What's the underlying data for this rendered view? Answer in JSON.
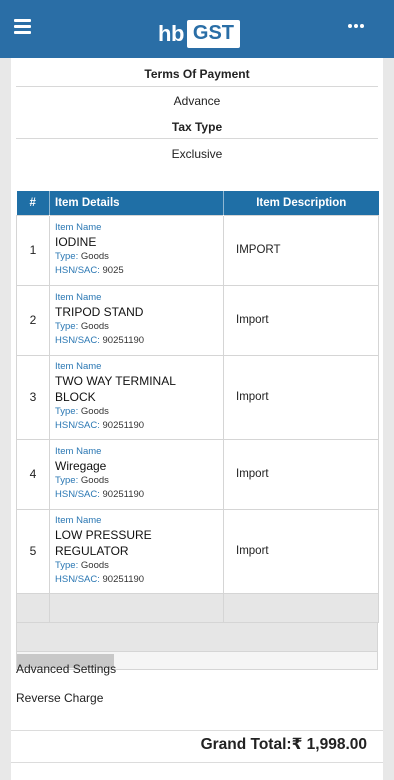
{
  "header": {
    "logo_hb": "hb",
    "logo_gst": "GST"
  },
  "payment": {
    "terms_label": "Terms Of Payment",
    "terms_value": "Advance",
    "tax_type_label": "Tax Type",
    "tax_type_value": "Exclusive"
  },
  "table": {
    "columns": [
      "#",
      "Item Details",
      "Item Description"
    ],
    "item_name_label": "Item Name",
    "type_label": "Type:",
    "hsn_label": "HSN/SAC:",
    "rows": [
      {
        "num": "1",
        "name": "IODINE",
        "type": "Goods",
        "hsn": "9025",
        "description": "IMPORT"
      },
      {
        "num": "2",
        "name": "TRIPOD STAND",
        "type": "Goods",
        "hsn": "90251190",
        "description": "Import"
      },
      {
        "num": "3",
        "name": "TWO WAY TERMINAL BLOCK",
        "type": "Goods",
        "hsn": "90251190",
        "description": "Import"
      },
      {
        "num": "4",
        "name": "Wiregage",
        "type": "Goods",
        "hsn": "90251190",
        "description": "Import"
      },
      {
        "num": "5",
        "name": "LOW PRESSURE REGULATOR",
        "type": "Goods",
        "hsn": "90251190",
        "description": "Import"
      }
    ]
  },
  "settings": {
    "advanced_label": "Advanced Settings",
    "reverse_charge_label": "Reverse Charge"
  },
  "total": {
    "label": "Grand Total:",
    "amount": "₹ 1,998.00"
  }
}
